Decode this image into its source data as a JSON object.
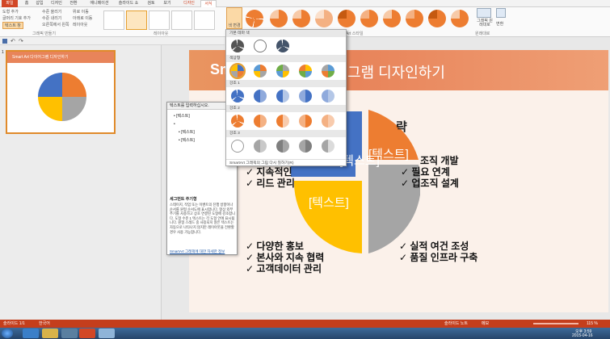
{
  "ribbon": {
    "tabs": [
      "파일",
      "홈",
      "삽입",
      "디자인",
      "전환",
      "애니메이션",
      "슬라이드 쇼",
      "검토",
      "보기",
      "디자인",
      "서식"
    ],
    "left_buttons": [
      "도형 추가",
      "글머리 기호 추가",
      "텍스트 창",
      "수준 올리기",
      "수준 내리기",
      "오른쪽에서 왼쪽",
      "위로 이동",
      "아래로 이동",
      "레이아웃"
    ],
    "groups": [
      "그래픽 만들기",
      "레이아웃",
      "Art 스타일",
      "원래대로"
    ],
    "reset_buttons": [
      "그래픽 원래대로",
      "변환"
    ],
    "color_change_label": "색 변경"
  },
  "thumbnail": {
    "number": "1",
    "title": "Smart Art 다이어그램 디자인하기"
  },
  "text_pane": {
    "header": "텍스트를 입력하십시오.",
    "items": [
      "[텍스트]",
      "",
      "[텍스트]",
      "[텍스트]"
    ],
    "desc_title": "세그먼트 주기형",
    "description": "스테이지, 작업 또는 이벤트의 진행 방향이나 순서를 원형 순서도에 표시합니다. 항상 외부 주기를 사용하고 상호 연결된 도형에 강조합니다. 도형 수준 1 텍스트는 각 도형 안에 표시됩니다. 원형 스레드 중 사용되지 않은 텍스트는 자동으로 나타나지 않지만 레이아웃을 전환할 경우 사용 가능합니다.",
    "link": "SmartArt 그래픽에 대한 자세한 정보"
  },
  "dropdown": {
    "sections": [
      "기본 테마 색",
      "색상형",
      "강조 1",
      "강조 2",
      "강조 3"
    ],
    "footer": "SmartArt 그래픽의 그림 다시 칠하기(R)"
  },
  "slide": {
    "title": "Smart Art 다이어그램 디자인하기",
    "title_visible_left": "Sm",
    "title_visible_right": "그램 디자인하기",
    "heading_partial": "략",
    "segment_labels": [
      "[텍스트]",
      "[텍스트]",
      "[텍스트]"
    ],
    "bullets_tl": [
      "지속적인",
      "리드 관리"
    ],
    "bullets_tr": [
      "조직 개발",
      "필요 연계",
      "업조직 설계"
    ],
    "bullets_bl": [
      "다양한 홍보",
      "본사와 지속 협력",
      "고객데이터 관리"
    ],
    "bullets_br": [
      "실적 여건 조성",
      "품질 인프라 구축"
    ]
  },
  "status": {
    "slide": "슬라이드 1/1",
    "lang": "한국어",
    "notes": "슬라이드 노트",
    "comments": "메모",
    "zoom": "115 %"
  },
  "taskbar": {
    "time": "오후 3:59",
    "date": "2015-04-16"
  },
  "colors": {
    "accent": "#d24726",
    "orange": "#ed7d31",
    "blue": "#4472c4",
    "yellow": "#ffc000",
    "gray": "#a5a5a5"
  }
}
